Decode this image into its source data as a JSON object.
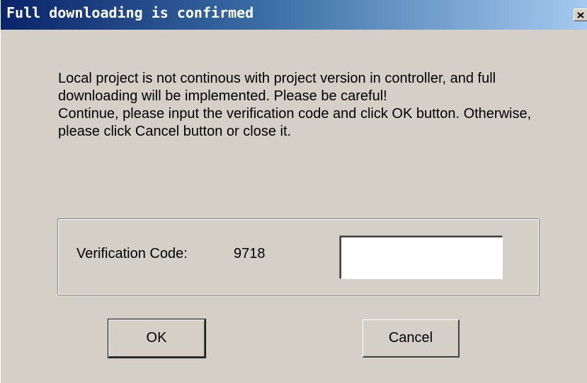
{
  "window": {
    "title": "Full downloading is confirmed",
    "close_icon": "close-icon",
    "titlebar_colors": [
      "#0a246a",
      "#a6caf0"
    ],
    "face_color": "#d4d0c8"
  },
  "message": {
    "paragraph1": "Local project is not continous with project version in controller, and full downloading will be implemented. Please be careful!",
    "paragraph2": "Continue, please input the verification code and click OK button. Otherwise, please click Cancel button or close it."
  },
  "verification": {
    "label": "Verification Code:",
    "code": "9718",
    "input_value": ""
  },
  "buttons": {
    "ok_label": "OK",
    "cancel_label": "Cancel"
  }
}
